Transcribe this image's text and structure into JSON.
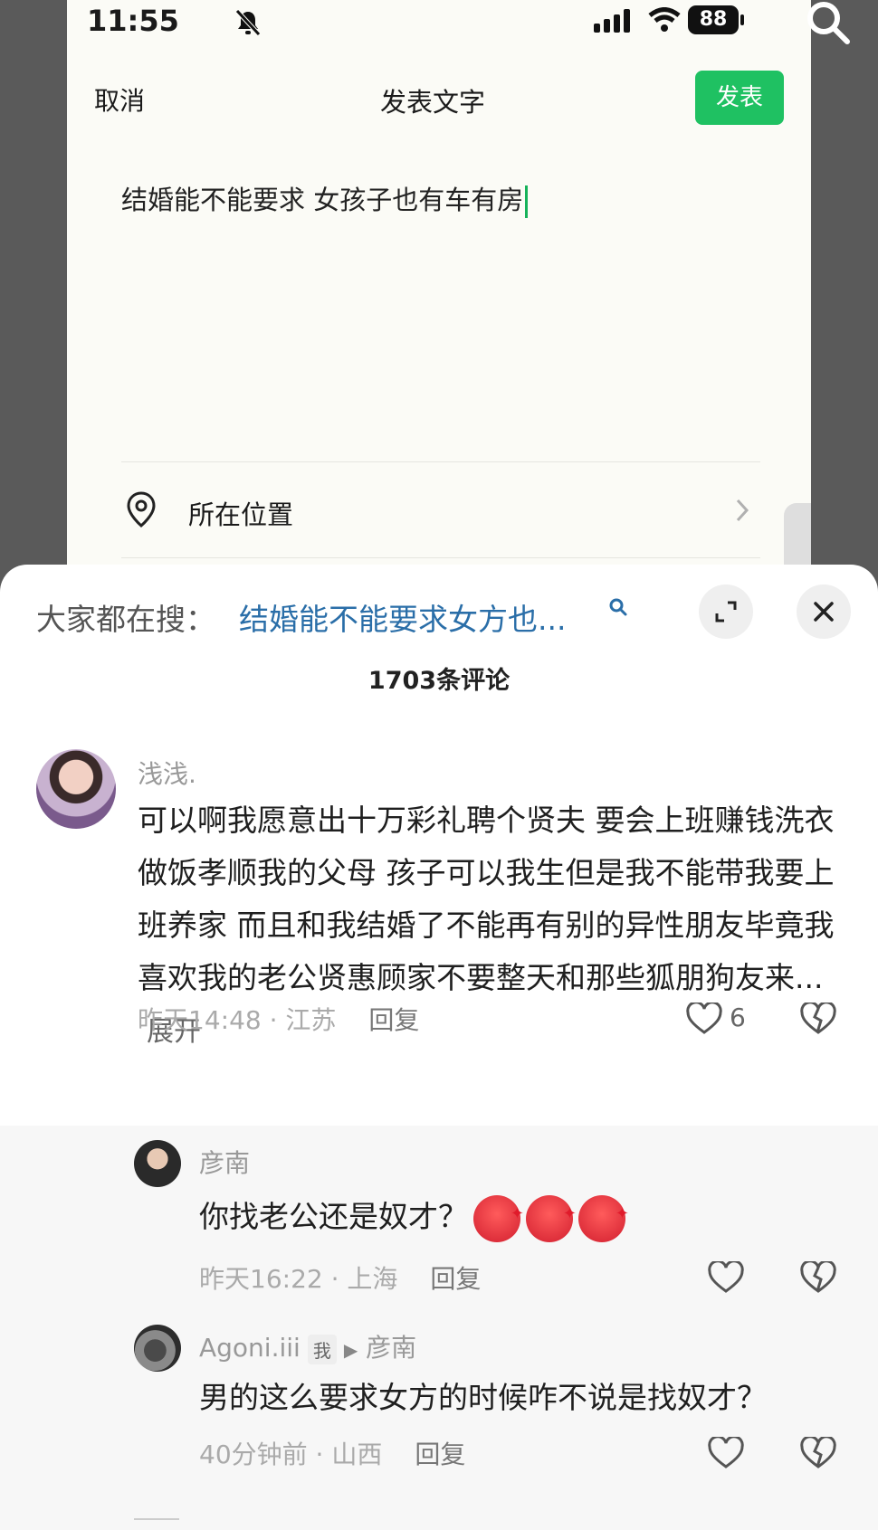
{
  "status_bar": {
    "time": "11:55",
    "battery": "88"
  },
  "compose": {
    "cancel_label": "取消",
    "title": "发表文字",
    "publish_label": "发表",
    "text": "结婚能不能要求 女孩子也有车有房",
    "location_label": "所在位置"
  },
  "panel": {
    "search_prefix": "大家都在搜：",
    "search_suggestion": "结婚能不能要求女方也...",
    "comment_count": "1703条评论"
  },
  "comments": [
    {
      "name": "浅浅.",
      "body": "可以啊我愿意出十万彩礼聘个贤夫 要会上班赚钱洗衣做饭孝顺我的父母 孩子可以我生但是我不能带我要上班养家  而且和我结婚了不能再有别的异性朋友毕竟我喜欢我的老公贤惠顾家不要整天和那些狐朋狗友来...",
      "expand_label": "展开",
      "time": "昨天14:48",
      "location": "江苏",
      "reply_label": "回复",
      "likes": "6"
    },
    {
      "name": "彦南",
      "body": "你找老公还是奴才？",
      "time": "昨天16:22",
      "location": "上海",
      "reply_label": "回复"
    },
    {
      "name": "Agoni.iii",
      "me_badge": "我",
      "reply_to": "彦南",
      "body": "男的这么要求女方的时候咋不说是找奴才？",
      "time": "40分钟前",
      "location": "山西",
      "reply_label": "回复"
    }
  ],
  "colors": {
    "publish_green": "#1fc162",
    "suggest_blue": "#2a6ea8"
  },
  "icons": [
    "bell-off-icon",
    "signal-icon",
    "wifi-icon",
    "search-icon",
    "location-pin-icon",
    "chevron-right-icon",
    "expand-icon",
    "close-icon",
    "heart-icon",
    "broken-heart-icon",
    "angry-emoji-icon"
  ]
}
